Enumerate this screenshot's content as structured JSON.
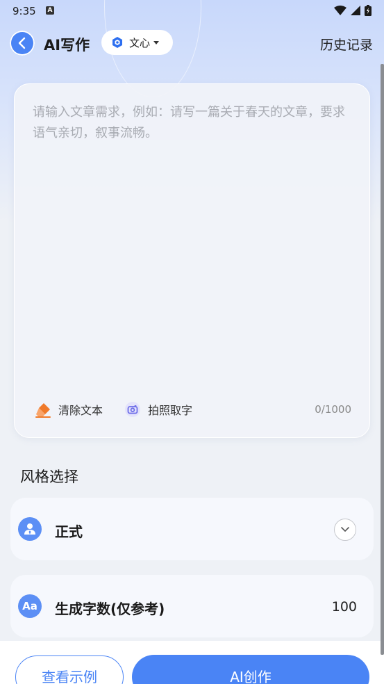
{
  "status_bar": {
    "time": "9:35",
    "notification_glyph": "A",
    "icons": [
      "wifi-icon",
      "signal-icon",
      "battery-icon"
    ]
  },
  "header": {
    "back_icon": "chevron-left-icon",
    "title": "AI写作",
    "model": {
      "label": "文心",
      "logo_icon": "wenxin-logo-icon",
      "caret_icon": "caret-down-icon"
    },
    "history_label": "历史记录"
  },
  "editor": {
    "value": "",
    "placeholder": "请输入文章需求，例如：请写一篇关于春天的文章，要求语气亲切，叙事流畅。",
    "clear_label": "清除文本",
    "clear_icon": "eraser-icon",
    "photo_label": "拍照取字",
    "photo_icon": "camera-icon",
    "char_count": "0/1000"
  },
  "style_section": {
    "title": "风格选择",
    "style": {
      "label": "正式",
      "icon": "person-icon",
      "toggle_icon": "chevron-down-icon"
    },
    "word_count": {
      "label": "生成字数(仅参考)",
      "badge": "Aa",
      "value": "100"
    }
  },
  "footer": {
    "example_label": "查看示例",
    "create_label": "AI创作"
  },
  "colors": {
    "accent": "#4a84f5",
    "clear_icon": "#f07a2a",
    "photo_icon": "#6d6de8"
  }
}
